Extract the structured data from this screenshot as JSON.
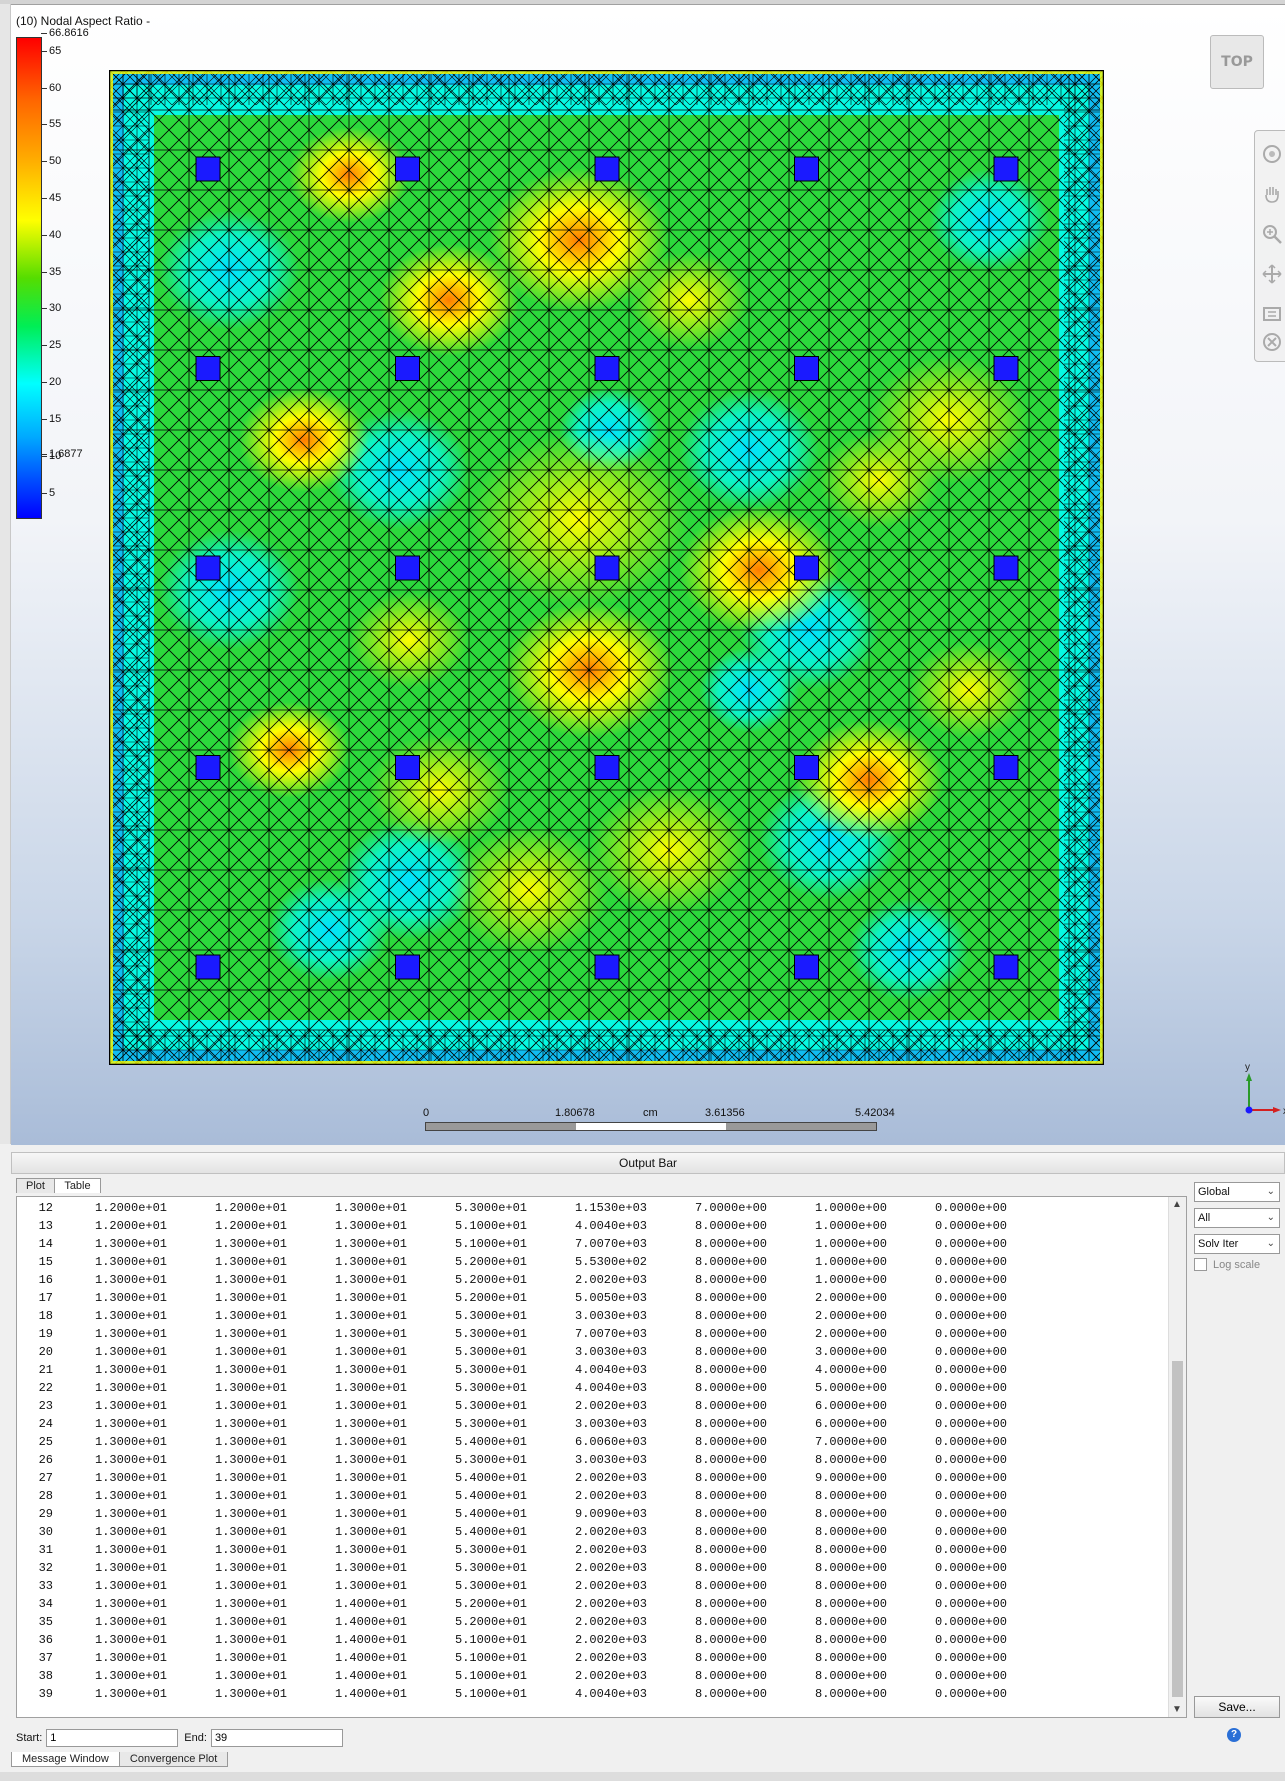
{
  "legend": {
    "title": "(10) Nodal Aspect Ratio -",
    "max": "66.8616",
    "min": "1.6877",
    "ticks": [
      "65",
      "60",
      "55",
      "50",
      "45",
      "40",
      "35",
      "30",
      "25",
      "20",
      "15",
      "10",
      "5"
    ]
  },
  "view": {
    "orientation_button": "TOP",
    "axis_x": "x",
    "axis_y": "y"
  },
  "scale": {
    "labels": [
      "0",
      "1.80678",
      "cm",
      "3.61356",
      "5.42034"
    ]
  },
  "output": {
    "title": "Output Bar",
    "tabs": [
      "Plot",
      "Table"
    ],
    "active_tab": "Table",
    "rows": [
      [
        "12",
        "1.2000e+01",
        "1.2000e+01",
        "1.3000e+01",
        "5.3000e+01",
        "1.1530e+03",
        "7.0000e+00",
        "1.0000e+00",
        "0.0000e+00"
      ],
      [
        "13",
        "1.2000e+01",
        "1.2000e+01",
        "1.3000e+01",
        "5.1000e+01",
        "4.0040e+03",
        "8.0000e+00",
        "1.0000e+00",
        "0.0000e+00"
      ],
      [
        "14",
        "1.3000e+01",
        "1.3000e+01",
        "1.3000e+01",
        "5.1000e+01",
        "7.0070e+03",
        "8.0000e+00",
        "1.0000e+00",
        "0.0000e+00"
      ],
      [
        "15",
        "1.3000e+01",
        "1.3000e+01",
        "1.3000e+01",
        "5.2000e+01",
        "5.5300e+02",
        "8.0000e+00",
        "1.0000e+00",
        "0.0000e+00"
      ],
      [
        "16",
        "1.3000e+01",
        "1.3000e+01",
        "1.3000e+01",
        "5.2000e+01",
        "2.0020e+03",
        "8.0000e+00",
        "1.0000e+00",
        "0.0000e+00"
      ],
      [
        "17",
        "1.3000e+01",
        "1.3000e+01",
        "1.3000e+01",
        "5.2000e+01",
        "5.0050e+03",
        "8.0000e+00",
        "2.0000e+00",
        "0.0000e+00"
      ],
      [
        "18",
        "1.3000e+01",
        "1.3000e+01",
        "1.3000e+01",
        "5.3000e+01",
        "3.0030e+03",
        "8.0000e+00",
        "2.0000e+00",
        "0.0000e+00"
      ],
      [
        "19",
        "1.3000e+01",
        "1.3000e+01",
        "1.3000e+01",
        "5.3000e+01",
        "7.0070e+03",
        "8.0000e+00",
        "2.0000e+00",
        "0.0000e+00"
      ],
      [
        "20",
        "1.3000e+01",
        "1.3000e+01",
        "1.3000e+01",
        "5.3000e+01",
        "3.0030e+03",
        "8.0000e+00",
        "3.0000e+00",
        "0.0000e+00"
      ],
      [
        "21",
        "1.3000e+01",
        "1.3000e+01",
        "1.3000e+01",
        "5.3000e+01",
        "4.0040e+03",
        "8.0000e+00",
        "4.0000e+00",
        "0.0000e+00"
      ],
      [
        "22",
        "1.3000e+01",
        "1.3000e+01",
        "1.3000e+01",
        "5.3000e+01",
        "4.0040e+03",
        "8.0000e+00",
        "5.0000e+00",
        "0.0000e+00"
      ],
      [
        "23",
        "1.3000e+01",
        "1.3000e+01",
        "1.3000e+01",
        "5.3000e+01",
        "2.0020e+03",
        "8.0000e+00",
        "6.0000e+00",
        "0.0000e+00"
      ],
      [
        "24",
        "1.3000e+01",
        "1.3000e+01",
        "1.3000e+01",
        "5.3000e+01",
        "3.0030e+03",
        "8.0000e+00",
        "6.0000e+00",
        "0.0000e+00"
      ],
      [
        "25",
        "1.3000e+01",
        "1.3000e+01",
        "1.3000e+01",
        "5.4000e+01",
        "6.0060e+03",
        "8.0000e+00",
        "7.0000e+00",
        "0.0000e+00"
      ],
      [
        "26",
        "1.3000e+01",
        "1.3000e+01",
        "1.3000e+01",
        "5.3000e+01",
        "3.0030e+03",
        "8.0000e+00",
        "8.0000e+00",
        "0.0000e+00"
      ],
      [
        "27",
        "1.3000e+01",
        "1.3000e+01",
        "1.3000e+01",
        "5.4000e+01",
        "2.0020e+03",
        "8.0000e+00",
        "9.0000e+00",
        "0.0000e+00"
      ],
      [
        "28",
        "1.3000e+01",
        "1.3000e+01",
        "1.3000e+01",
        "5.4000e+01",
        "2.0020e+03",
        "8.0000e+00",
        "8.0000e+00",
        "0.0000e+00"
      ],
      [
        "29",
        "1.3000e+01",
        "1.3000e+01",
        "1.3000e+01",
        "5.4000e+01",
        "9.0090e+03",
        "8.0000e+00",
        "8.0000e+00",
        "0.0000e+00"
      ],
      [
        "30",
        "1.3000e+01",
        "1.3000e+01",
        "1.3000e+01",
        "5.4000e+01",
        "2.0020e+03",
        "8.0000e+00",
        "8.0000e+00",
        "0.0000e+00"
      ],
      [
        "31",
        "1.3000e+01",
        "1.3000e+01",
        "1.3000e+01",
        "5.3000e+01",
        "2.0020e+03",
        "8.0000e+00",
        "8.0000e+00",
        "0.0000e+00"
      ],
      [
        "32",
        "1.3000e+01",
        "1.3000e+01",
        "1.3000e+01",
        "5.3000e+01",
        "2.0020e+03",
        "8.0000e+00",
        "8.0000e+00",
        "0.0000e+00"
      ],
      [
        "33",
        "1.3000e+01",
        "1.3000e+01",
        "1.3000e+01",
        "5.3000e+01",
        "2.0020e+03",
        "8.0000e+00",
        "8.0000e+00",
        "0.0000e+00"
      ],
      [
        "34",
        "1.3000e+01",
        "1.3000e+01",
        "1.4000e+01",
        "5.2000e+01",
        "2.0020e+03",
        "8.0000e+00",
        "8.0000e+00",
        "0.0000e+00"
      ],
      [
        "35",
        "1.3000e+01",
        "1.3000e+01",
        "1.4000e+01",
        "5.2000e+01",
        "2.0020e+03",
        "8.0000e+00",
        "8.0000e+00",
        "0.0000e+00"
      ],
      [
        "36",
        "1.3000e+01",
        "1.3000e+01",
        "1.4000e+01",
        "5.1000e+01",
        "2.0020e+03",
        "8.0000e+00",
        "8.0000e+00",
        "0.0000e+00"
      ],
      [
        "37",
        "1.3000e+01",
        "1.3000e+01",
        "1.4000e+01",
        "5.1000e+01",
        "2.0020e+03",
        "8.0000e+00",
        "8.0000e+00",
        "0.0000e+00"
      ],
      [
        "38",
        "1.3000e+01",
        "1.3000e+01",
        "1.4000e+01",
        "5.1000e+01",
        "2.0020e+03",
        "8.0000e+00",
        "8.0000e+00",
        "0.0000e+00"
      ],
      [
        "39",
        "1.3000e+01",
        "1.3000e+01",
        "1.4000e+01",
        "5.1000e+01",
        "4.0040e+03",
        "8.0000e+00",
        "8.0000e+00",
        "0.0000e+00"
      ]
    ]
  },
  "controls": {
    "coord_select": "Global",
    "filter_select": "All",
    "xaxis_select": "Solv Iter",
    "log_scale_label": "Log scale",
    "log_scale_checked": false,
    "save_label": "Save...",
    "start_label": "Start:",
    "start_value": "1",
    "end_label": "End:",
    "end_value": "39"
  },
  "bottom_tabs": [
    "Message Window",
    "Convergence Plot"
  ],
  "colors": {
    "pad": "#1a1aff",
    "mesh_line": "#000000",
    "frame": "#000000"
  }
}
